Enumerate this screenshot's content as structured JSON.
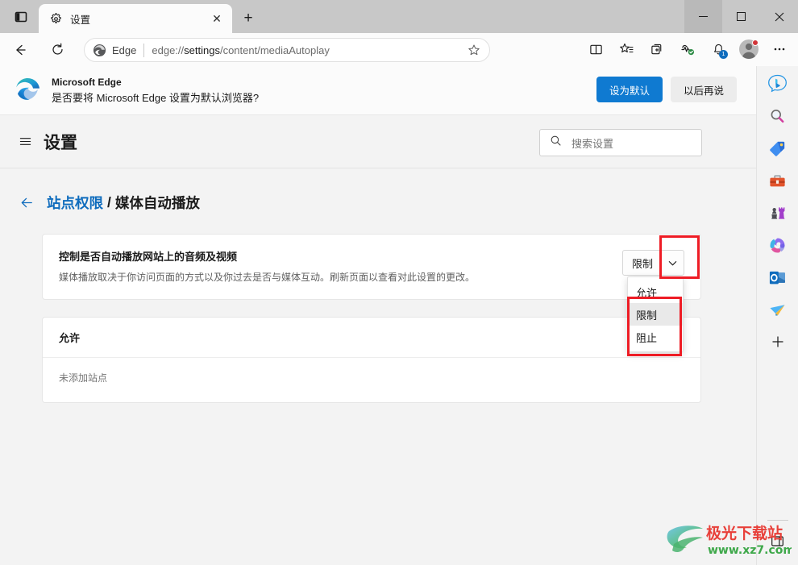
{
  "window": {
    "tab_actions_icon": "vertical-tabs-icon",
    "minimize_label": "—",
    "maximize_label": "☐",
    "close_label": "✕"
  },
  "tabs": [
    {
      "title": "设置",
      "favicon": "gear-icon",
      "close_label": "✕"
    }
  ],
  "newtab_label": "+",
  "toolbar": {
    "back_icon": "arrow-left-icon",
    "refresh_icon": "reload-icon",
    "edge_chip_label": "Edge",
    "url_prefix": "edge://",
    "url_bold": "settings",
    "url_suffix": "/content/mediaAutoplay",
    "url_full": "edge://settings/content/mediaAutoplay",
    "favorite_icon": "star-icon",
    "right_icons": [
      {
        "name": "split-screen-icon"
      },
      {
        "name": "favorites-icon"
      },
      {
        "name": "collections-icon"
      },
      {
        "name": "browser-essentials-icon"
      },
      {
        "name": "notifications-bell-icon",
        "badge": "1"
      },
      {
        "name": "profile-avatar",
        "badge_dot": true
      },
      {
        "name": "more-settings-icon"
      }
    ]
  },
  "default_browser_banner": {
    "logo": "edge-logo-icon",
    "title": "Microsoft Edge",
    "question": "是否要将 Microsoft Edge 设置为默认浏览器?",
    "primary_button": "设为默认",
    "secondary_button": "以后再说"
  },
  "settings_header": {
    "menu_icon": "hamburger-menu-icon",
    "title": "设置",
    "search_icon": "search-icon",
    "search_placeholder": "搜索设置",
    "search_value": ""
  },
  "breadcrumb": {
    "back_icon": "arrow-left-icon",
    "parent": "站点权限",
    "separator": "/",
    "current": "媒体自动播放"
  },
  "setting_card": {
    "title": "控制是否自动播放网站上的音频及视频",
    "description": "媒体播放取决于你访问页面的方式以及你过去是否与媒体互动。刷新页面以查看对此设置的更改。",
    "select_value": "限制",
    "chevron_icon": "chevron-down-icon",
    "options": [
      {
        "label": "允许",
        "selected": false
      },
      {
        "label": "限制",
        "selected": true
      },
      {
        "label": "阻止",
        "selected": false
      }
    ]
  },
  "allow_card": {
    "title": "允许",
    "empty_text": "未添加站点"
  },
  "edge_bar": {
    "icons": [
      {
        "name": "bing-copilot-icon"
      },
      {
        "name": "search-icon"
      },
      {
        "name": "shopping-tag-icon"
      },
      {
        "name": "tools-briefcase-icon"
      },
      {
        "name": "games-chess-icon"
      },
      {
        "name": "microsoft-365-icon"
      },
      {
        "name": "outlook-icon"
      },
      {
        "name": "send-plane-icon"
      },
      {
        "name": "add-sidebar-app-icon",
        "label": "+"
      }
    ],
    "bottom_icon": "sidebar-toggle-icon"
  },
  "watermark": {
    "title": "极光下载站",
    "url": "www.xz7.com"
  },
  "colors": {
    "accent_blue": "#0f7ad1",
    "link_blue": "#0f6cbd",
    "highlight_red": "#ee1c25",
    "page_bg": "#f3f3f3",
    "card_bg": "#ffffff"
  }
}
